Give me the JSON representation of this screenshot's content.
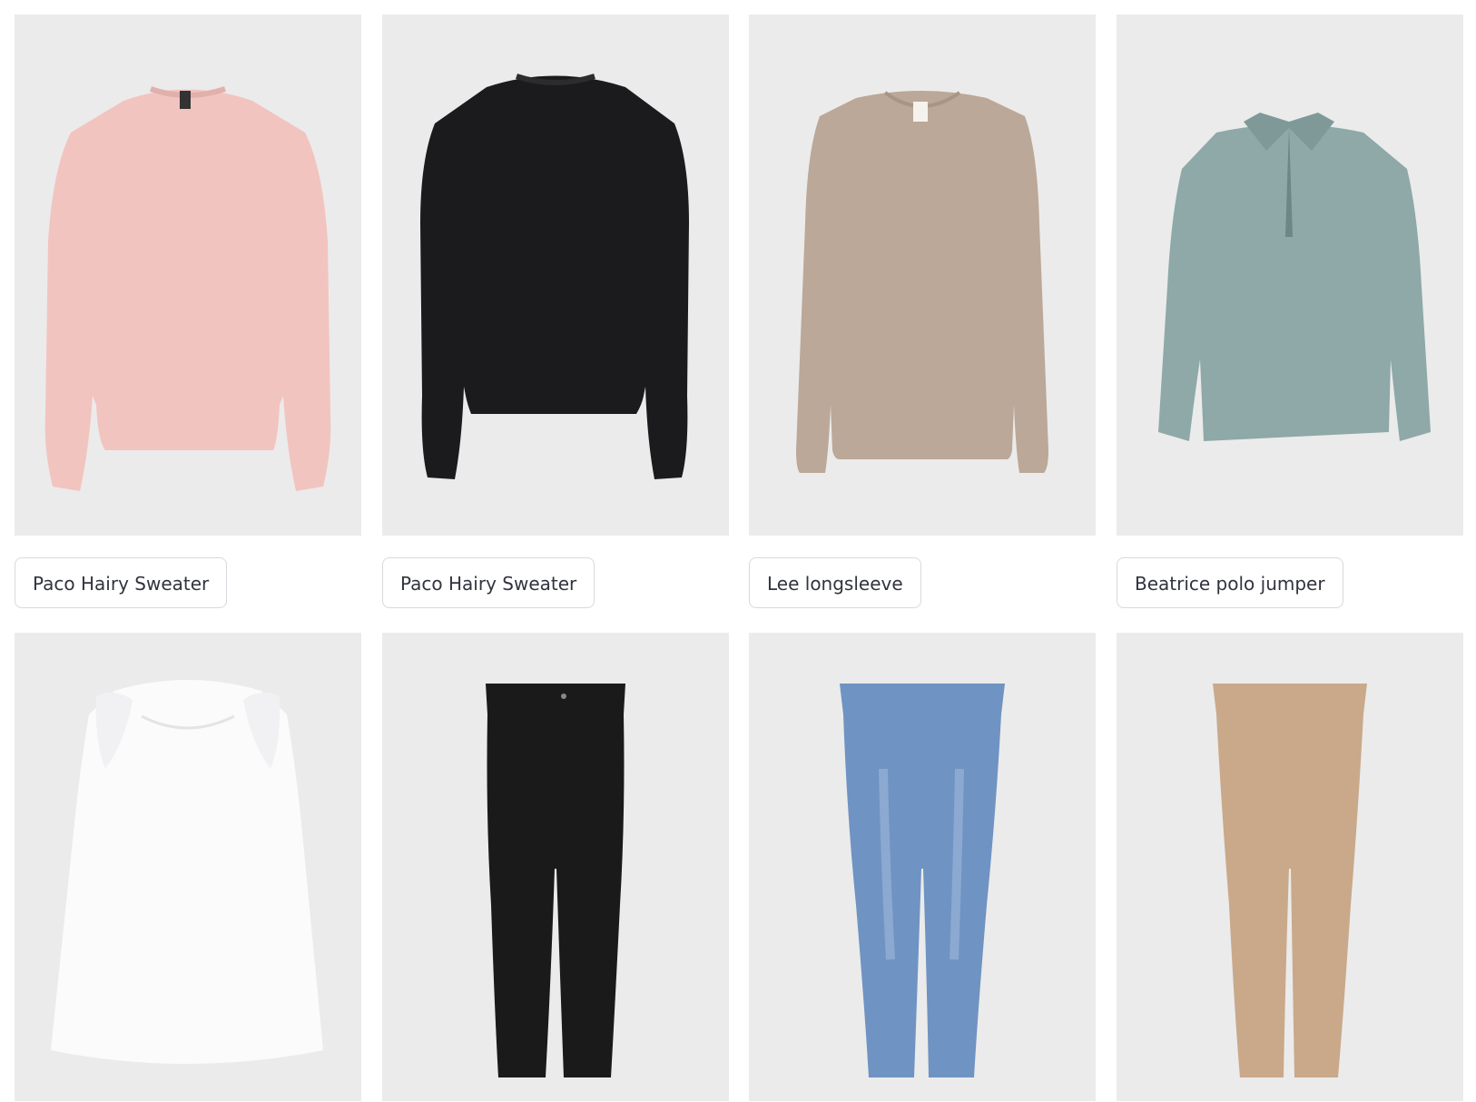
{
  "products": [
    {
      "name": "Paco Hairy Sweater",
      "color": "pink",
      "garment": "sweater",
      "hex": "#f2c4c0"
    },
    {
      "name": "Paco Hairy Sweater",
      "color": "black",
      "garment": "sweater",
      "hex": "#1b1b1d"
    },
    {
      "name": "Lee longsleeve",
      "color": "beige",
      "garment": "longsleeve",
      "hex": "#bba898"
    },
    {
      "name": "Beatrice polo jumper",
      "color": "sage",
      "garment": "polo-jumper",
      "hex": "#8fa8a8"
    },
    {
      "color": "white",
      "garment": "lace-top",
      "hex": "#fbfbfb"
    },
    {
      "color": "black",
      "garment": "jeans",
      "hex": "#1a1a1a"
    },
    {
      "color": "blue",
      "garment": "jeans",
      "hex": "#6f93c2"
    },
    {
      "color": "beige",
      "garment": "jeans",
      "hex": "#c9a98a"
    }
  ],
  "colors": {
    "photo_background": "#ebebeb",
    "button_border": "#d8d9de",
    "button_text": "#31333f"
  }
}
